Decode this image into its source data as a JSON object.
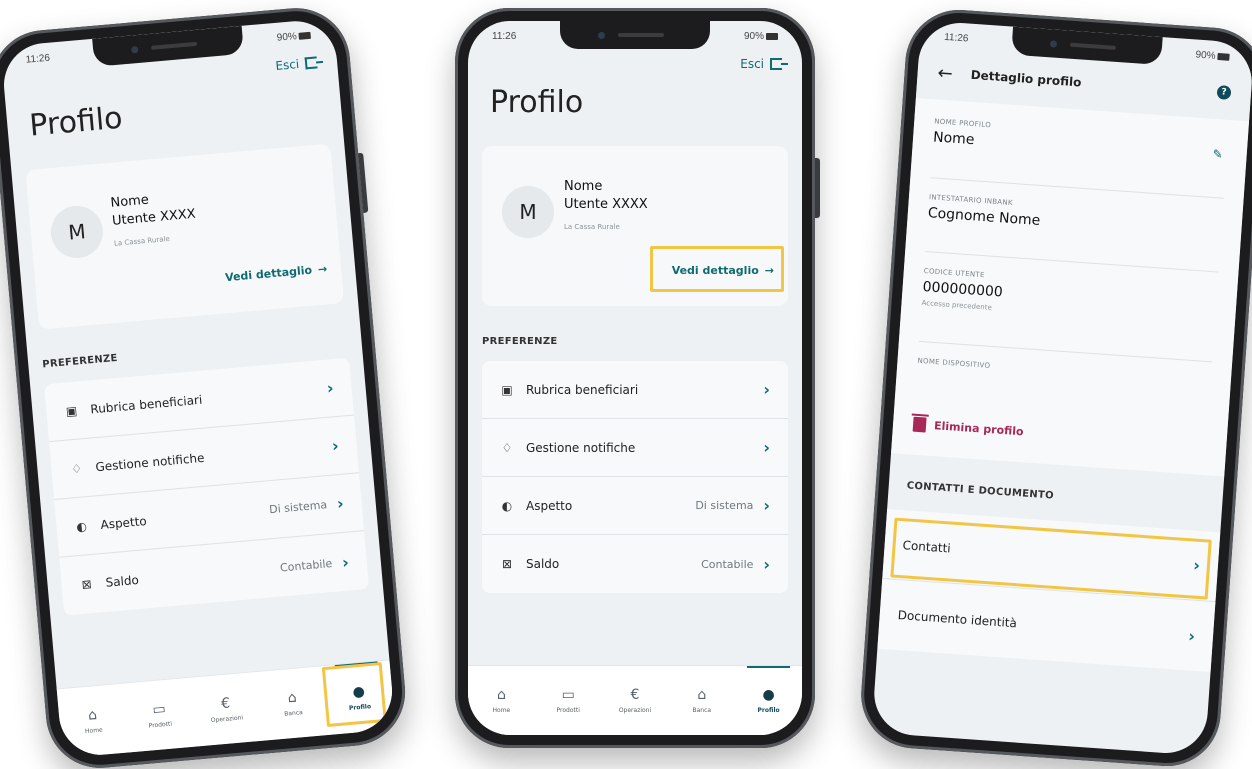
{
  "status": {
    "time": "11:26",
    "battery": "90%"
  },
  "profile": {
    "logout_label": "Esci",
    "title": "Profilo",
    "avatar_initial": "M",
    "name": "Nome",
    "user": "Utente XXXX",
    "bank": "La Cassa Rurale",
    "detail_link": "Vedi dettaglio",
    "section": "PREFERENZE",
    "menu": [
      {
        "label": "Rubrica beneficiari",
        "value": "",
        "icon": "contacts-book-icon"
      },
      {
        "label": "Gestione notifiche",
        "value": "",
        "icon": "bell-icon"
      },
      {
        "label": "Aspetto",
        "value": "Di sistema",
        "icon": "contrast-icon"
      },
      {
        "label": "Saldo",
        "value": "Contabile",
        "icon": "balance-icon"
      }
    ]
  },
  "tabs": [
    {
      "label": "Home",
      "icon": "home-icon"
    },
    {
      "label": "Prodotti",
      "icon": "wallet-icon"
    },
    {
      "label": "Operazioni",
      "icon": "euro-icon"
    },
    {
      "label": "Banca",
      "icon": "bank-icon"
    },
    {
      "label": "Profilo",
      "icon": "person-icon"
    }
  ],
  "detail": {
    "header": "Dettaglio profilo",
    "fields": [
      {
        "label": "NOME PROFILO",
        "value": "Nome"
      },
      {
        "label": "INTESTATARIO INBANK",
        "value": "Cognome Nome"
      },
      {
        "label": "CODICE UTENTE",
        "value": "000000000",
        "sub": "Accesso precedente"
      },
      {
        "label": "NOME DISPOSITIVO",
        "value": ""
      }
    ],
    "delete_label": "Elimina profilo",
    "section": "CONTATTI E DOCUMENTO",
    "rows": [
      {
        "label": "Contatti"
      },
      {
        "label": "Documento identità"
      }
    ]
  },
  "colors": {
    "accent": "#0f6b71",
    "highlight": "#f2c544",
    "danger": "#a8285a"
  }
}
